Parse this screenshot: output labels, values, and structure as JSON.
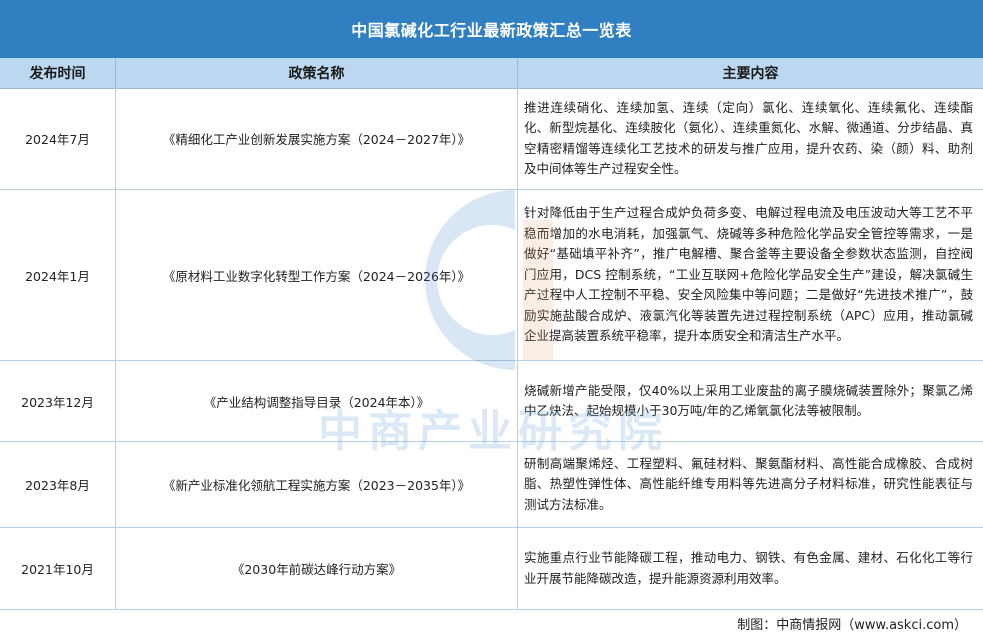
{
  "title": "中国氯碱化工行业最新政策汇总一览表",
  "headers": {
    "date": "发布时间",
    "name": "政策名称",
    "content": "主要内容"
  },
  "rows": [
    {
      "date": "2024年7月",
      "name": "《精细化工产业创新发展实施方案（2024－2027年）》",
      "content": "推进连续硝化、连续加氢、连续（定向）氯化、连续氧化、连续氟化、连续酯化、新型烷基化、连续胺化（氨化）、连续重氮化、水解、微通道、分步结晶、真空精密精馏等连续化工艺技术的研发与推广应用，提升农药、染（颜）料、助剂及中间体等生产过程安全性。"
    },
    {
      "date": "2024年1月",
      "name": "《原材料工业数字化转型工作方案（2024－2026年）》",
      "content": "针对降低由于生产过程合成炉负荷多变、电解过程电流及电压波动大等工艺不平稳而增加的水电消耗，加强氯气、烧碱等多种危险化学品安全管控等需求，一是做好“基础填平补齐”，推广电解槽、聚合釜等主要设备全参数状态监测，自控阀门应用，DCS 控制系统，“工业互联网+危险化学品安全生产”建设，解决氯碱生产过程中人工控制不平稳、安全风险集中等问题；二是做好“先进技术推广”，鼓励实施盐酸合成炉、液氯汽化等装置先进过程控制系统（APC）应用，推动氯碱企业提高装置系统平稳率，提升本质安全和清洁生产水平。"
    },
    {
      "date": "2023年12月",
      "name": "《产业结构调整指导目录（2024年本）》",
      "content": "烧碱新增产能受限，仅40%以上采用工业废盐的离子膜烧碱装置除外；聚氯乙烯中乙炔法、起始规模小于30万吨/年的乙烯氧氯化法等被限制。"
    },
    {
      "date": "2023年8月",
      "name": "《新产业标准化领航工程实施方案（2023－2035年）》",
      "content": "研制高端聚烯烃、工程塑料、氟硅材料、聚氨酯材料、高性能合成橡胶、合成树脂、热塑性弹性体、高性能纤维专用料等先进高分子材料标准，研究性能表征与测试方法标准。"
    },
    {
      "date": "2021年10月",
      "name": "《2030年前碳达峰行动方案》",
      "content": "实施重点行业节能降碳工程，推动电力、钢铁、有色金属、建材、石化化工等行业开展节能降碳改造，提升能源资源利用效率。"
    }
  ],
  "footer": "制图：中商情报网（www.askci.com）",
  "watermark": "中商产业研究院",
  "colors": {
    "title_bg": "#2f7fc1",
    "header_bg": "#bcd8f0"
  }
}
